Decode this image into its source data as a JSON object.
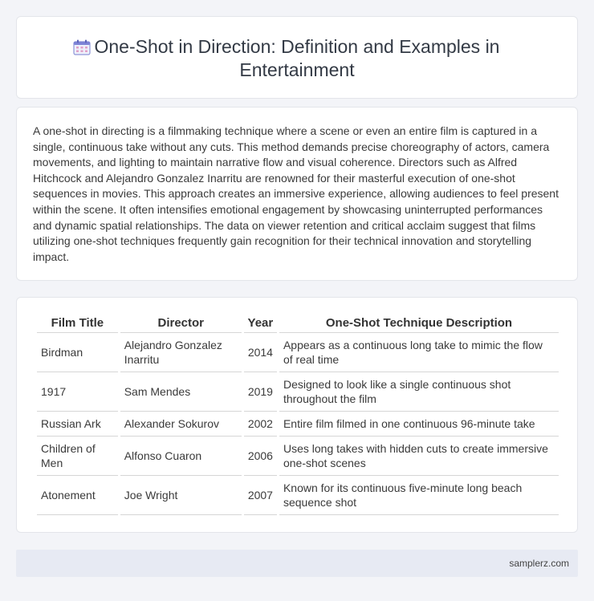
{
  "header": {
    "title": "One-Shot in Direction: Definition and Examples in Entertainment",
    "icon": "calendar-icon"
  },
  "intro": {
    "text": "A one-shot in directing is a filmmaking technique where a scene or even an entire film is captured in a single, continuous take without any cuts. This method demands precise choreography of actors, camera movements, and lighting to maintain narrative flow and visual coherence. Directors such as Alfred Hitchcock and Alejandro Gonzalez Inarritu are renowned for their masterful execution of one-shot sequences in movies. This approach creates an immersive experience, allowing audiences to feel present within the scene. It often intensifies emotional engagement by showcasing uninterrupted performances and dynamic spatial relationships. The data on viewer retention and critical acclaim suggest that films utilizing one-shot techniques frequently gain recognition for their technical innovation and storytelling impact."
  },
  "table": {
    "headers": [
      "Film Title",
      "Director",
      "Year",
      "One-Shot Technique Description"
    ],
    "rows": [
      [
        "Birdman",
        "Alejandro Gonzalez Inarritu",
        "2014",
        "Appears as a continuous long take to mimic the flow of real time"
      ],
      [
        "1917",
        "Sam Mendes",
        "2019",
        "Designed to look like a single continuous shot throughout the film"
      ],
      [
        "Russian Ark",
        "Alexander Sokurov",
        "2002",
        "Entire film filmed in one continuous 96-minute take"
      ],
      [
        "Children of Men",
        "Alfonso Cuaron",
        "2006",
        "Uses long takes with hidden cuts to create immersive one-shot scenes"
      ],
      [
        "Atonement",
        "Joe Wright",
        "2007",
        "Known for its continuous five-minute long beach sequence shot"
      ]
    ]
  },
  "footer": {
    "site": "samplerz.com"
  }
}
